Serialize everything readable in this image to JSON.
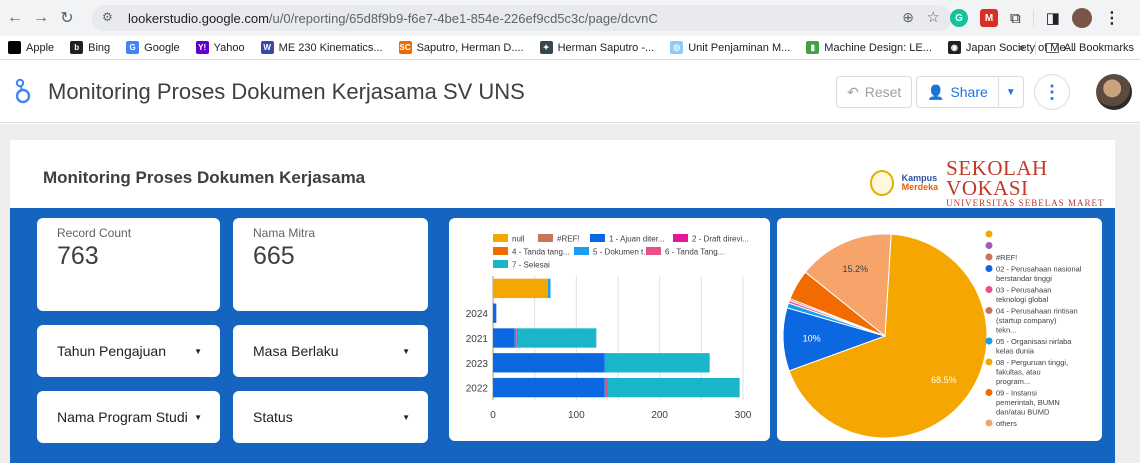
{
  "browser": {
    "url_host": "lookerstudio.google.com",
    "url_path": "/u/0/reporting/65d8f9b9-f6e7-4be1-854e-226ef9cd5c3c/page/dcvnC",
    "bookmarks": [
      {
        "label": "Apple",
        "color": "#000000",
        "glyph": ""
      },
      {
        "label": "Bing",
        "color": "#202124",
        "glyph": "b"
      },
      {
        "label": "Google",
        "color": "#4285f4",
        "glyph": "G"
      },
      {
        "label": "Yahoo",
        "color": "#6001d2",
        "glyph": "Y!"
      },
      {
        "label": "ME 230 Kinematics...",
        "color": "#3949ab",
        "glyph": "W"
      },
      {
        "label": "Saputro, Herman D....",
        "color": "#ef6c00",
        "glyph": "SC"
      },
      {
        "label": "Herman Saputro -...",
        "color": "#37474f",
        "glyph": "✦"
      },
      {
        "label": "Unit Penjaminan M...",
        "color": "#90caf9",
        "glyph": "◎"
      },
      {
        "label": "Machine Design: LE...",
        "color": "#43a047",
        "glyph": "▮"
      },
      {
        "label": "Japan Society of Me...",
        "color": "#202124",
        "glyph": "◉"
      }
    ],
    "bookmarks_more": "»",
    "all_bookmarks": "All Bookmarks"
  },
  "app": {
    "title": "Monitoring Proses Dokumen Kerjasama SV UNS",
    "reset_label": "Reset",
    "share_label": "Share"
  },
  "report": {
    "title": "Monitoring Proses Dokumen Kerjasama",
    "logo": {
      "km_line1": "Kampus",
      "km_line2": "Merdeka",
      "sv_line1": "SEKOLAH VOKASI",
      "sv_line2": "UNIVERSITAS SEBELAS MARET"
    },
    "scorecards": [
      {
        "label": "Record Count",
        "value": "763"
      },
      {
        "label": "Nama Mitra",
        "value": "665"
      }
    ],
    "filters": [
      {
        "label": "Tahun Pengajuan"
      },
      {
        "label": "Masa Berlaku"
      },
      {
        "label": "Nama Program Studi"
      },
      {
        "label": "Status"
      }
    ]
  },
  "chart_data": [
    {
      "type": "bar",
      "orientation": "horizontal",
      "stacked": true,
      "categories": [
        "",
        "2024",
        "2021",
        "2023",
        "2022"
      ],
      "series": [
        {
          "name": "null",
          "color": "#f6a600",
          "values": [
            66,
            0,
            0,
            0,
            0
          ]
        },
        {
          "name": "#REF!",
          "color": "#c9735e",
          "values": [
            0,
            0,
            0,
            0,
            0
          ]
        },
        {
          "name": "1 - Ajuan diter...",
          "color": "#0b68e0",
          "values": [
            0,
            4,
            26,
            134,
            134
          ]
        },
        {
          "name": "2 - Draft direvi...",
          "color": "#e6159a",
          "values": [
            0,
            0,
            0,
            0,
            0
          ]
        },
        {
          "name": "4 - Tanda tang...",
          "color": "#f26b00",
          "values": [
            0,
            0,
            0,
            0,
            0
          ]
        },
        {
          "name": "5 - Dokumen t...",
          "color": "#1a9ff0",
          "values": [
            3,
            0,
            2,
            1,
            1
          ]
        },
        {
          "name": "6 - Tanda Tang...",
          "color": "#e8508a",
          "values": [
            0,
            0,
            2,
            0,
            3
          ]
        },
        {
          "name": "7 - Selesai",
          "color": "#19b6c9",
          "values": [
            0,
            0,
            94,
            125,
            158
          ]
        }
      ],
      "x_ticks": [
        "0",
        "100",
        "200",
        "300"
      ],
      "xlim": [
        0,
        300
      ],
      "grid": true,
      "legend_position": "top"
    },
    {
      "type": "pie",
      "donut": true,
      "slices": [
        {
          "label": "",
          "color": "#f6a600",
          "value": 0
        },
        {
          "label": "",
          "color": "#9c5fbf",
          "value": 0
        },
        {
          "label": "#REF!",
          "color": "#c9735e",
          "value": 0
        },
        {
          "label": "02 - Perusahaan nasional berstandar tinggi",
          "color": "#0b68e0",
          "value": 10.0,
          "display": "10%"
        },
        {
          "label": "03 - Perusahaan teknologi global",
          "color": "#e8508a",
          "value": 0.4
        },
        {
          "label": "04 - Perusahaan rintisan (startup company) tekn...",
          "color": "#c9735e",
          "value": 0.3
        },
        {
          "label": "05 - Organisasi nirlaba kelas dunia",
          "color": "#1a9ff0",
          "value": 0.8
        },
        {
          "label": "08 - Perguruan tinggi, fakultas, atau program...",
          "color": "#f6a600",
          "value": 68.5,
          "display": "68.5%"
        },
        {
          "label": "09 - Instansi pemerintah, BUMN dan/atau BUMD",
          "color": "#f26b00",
          "value": 4.8
        },
        {
          "label": "others",
          "color": "#f7a46b",
          "value": 15.2,
          "display": "15.2%"
        }
      ],
      "legend_position": "right"
    }
  ]
}
